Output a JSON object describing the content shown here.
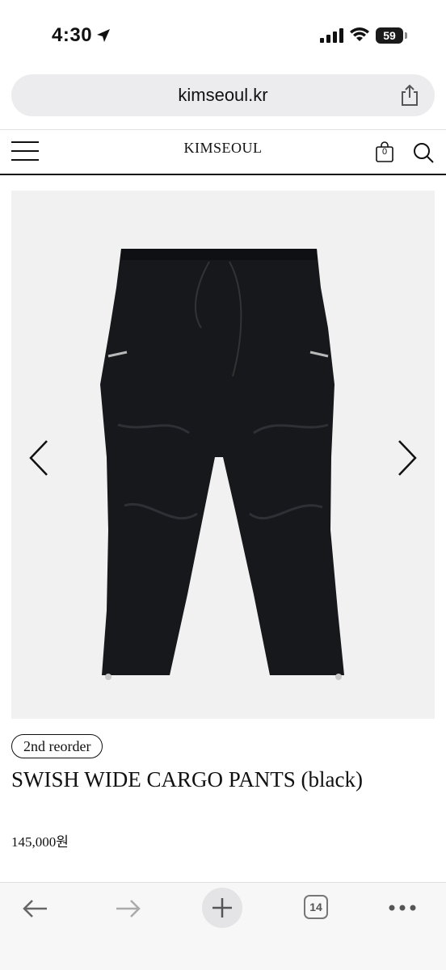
{
  "status_bar": {
    "time": "4:30",
    "battery": "59"
  },
  "browser": {
    "url": "kimseoul.kr",
    "tab_count": "14"
  },
  "site": {
    "logo": "KIMSEOUL",
    "cart_count": "0"
  },
  "product": {
    "badge": "2nd reorder",
    "title": "SWISH WIDE CARGO PANTS (black)",
    "price": "145,000원",
    "image_subject": "black wide cargo pants"
  },
  "icons": {
    "location": "location-arrow-icon",
    "signal": "cellular-signal-icon",
    "wifi": "wifi-icon",
    "share": "share-icon",
    "menu": "hamburger-menu-icon",
    "cart": "shopping-bag-icon",
    "search": "search-icon",
    "prev": "chevron-left-icon",
    "next": "chevron-right-icon",
    "back": "back-arrow-icon",
    "forward": "forward-arrow-icon",
    "new_tab": "plus-icon",
    "more": "more-icon"
  },
  "colors": {
    "accent": "#111111",
    "url_bar": "#ececee",
    "toolbar": "#f7f7f7"
  }
}
